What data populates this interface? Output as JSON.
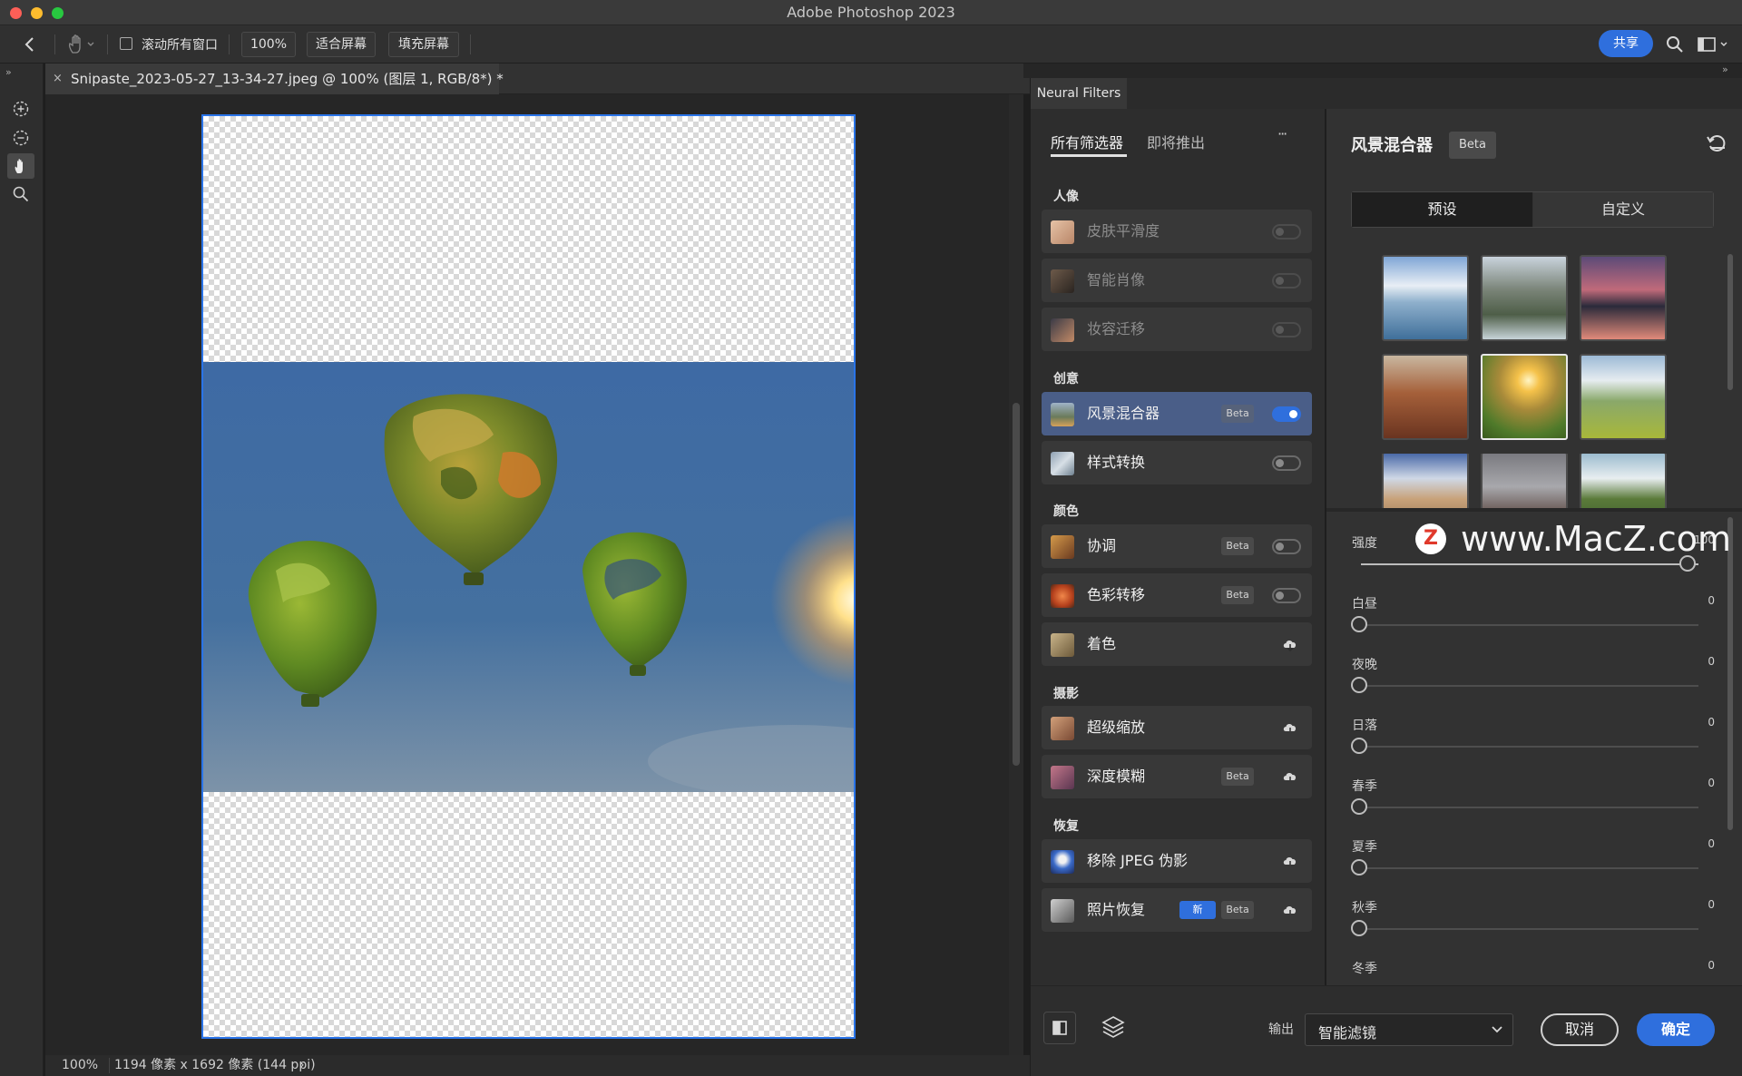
{
  "app": {
    "title": "Adobe Photoshop 2023"
  },
  "options": {
    "scroll_all": "滚动所有窗口",
    "zoom": "100%",
    "fit_screen": "适合屏幕",
    "fill_screen": "填充屏幕",
    "share": "共享"
  },
  "document": {
    "tab_title": "Snipaste_2023-05-27_13-34-27.jpeg @ 100% (图层 1, RGB/8*) *",
    "close": "×"
  },
  "status": {
    "zoom": "100%",
    "info": "1194 像素 x 1692 像素 (144 ppi)",
    "arrow": "›"
  },
  "neural": {
    "panel_tab": "Neural Filters",
    "tabs": [
      "所有筛选器",
      "即将推出"
    ],
    "more": "···",
    "categories": [
      {
        "name": "人像",
        "filters": [
          {
            "name": "皮肤平滑度",
            "state": "disabled",
            "badges": []
          },
          {
            "name": "智能肖像",
            "state": "disabled",
            "badges": []
          },
          {
            "name": "妆容迁移",
            "state": "disabled",
            "badges": []
          }
        ]
      },
      {
        "name": "创意",
        "filters": [
          {
            "name": "风景混合器",
            "state": "on",
            "badges": [
              "Beta"
            ]
          },
          {
            "name": "样式转换",
            "state": "off",
            "badges": []
          }
        ]
      },
      {
        "name": "颜色",
        "filters": [
          {
            "name": "协调",
            "state": "off",
            "badges": [
              "Beta"
            ]
          },
          {
            "name": "色彩转移",
            "state": "off",
            "badges": [
              "Beta"
            ]
          },
          {
            "name": "着色",
            "state": "cloud",
            "badges": []
          }
        ]
      },
      {
        "name": "摄影",
        "filters": [
          {
            "name": "超级缩放",
            "state": "cloud",
            "badges": []
          },
          {
            "name": "深度模糊",
            "state": "cloud",
            "badges": [
              "Beta"
            ]
          }
        ]
      },
      {
        "name": "恢复",
        "filters": [
          {
            "name": "移除 JPEG 伪影",
            "state": "cloud",
            "badges": []
          },
          {
            "name": "照片恢复",
            "state": "cloud",
            "badges": [
              "新",
              "Beta"
            ]
          }
        ]
      }
    ],
    "detail": {
      "title": "风景混合器",
      "badge": "Beta",
      "segments": [
        "预设",
        "自定义"
      ],
      "sliders": [
        {
          "label": "强度",
          "value": "100"
        },
        {
          "label": "白昼",
          "value": "0"
        },
        {
          "label": "夜晚",
          "value": "0"
        },
        {
          "label": "日落",
          "value": "0"
        },
        {
          "label": "春季",
          "value": "0"
        },
        {
          "label": "夏季",
          "value": "0"
        },
        {
          "label": "秋季",
          "value": "0"
        },
        {
          "label": "冬季",
          "value": "0"
        }
      ]
    },
    "bottom": {
      "output_label": "输出",
      "output_value": "智能滤镜",
      "cancel": "取消",
      "ok": "确定"
    }
  },
  "watermark": {
    "text": "www.MacZ.com",
    "logo": "Z"
  }
}
